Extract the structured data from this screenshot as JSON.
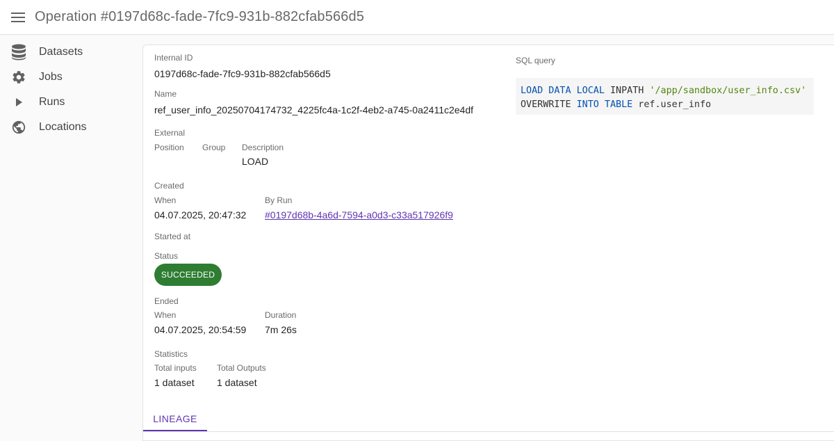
{
  "header": {
    "title": "Operation #0197d68c-fade-7fc9-931b-882cfab566d5",
    "menu_icon": "menu-icon"
  },
  "sidebar": {
    "items": [
      {
        "label": "Datasets",
        "icon": "database-icon"
      },
      {
        "label": "Jobs",
        "icon": "gear-icon"
      },
      {
        "label": "Runs",
        "icon": "play-icon"
      },
      {
        "label": "Locations",
        "icon": "globe-icon"
      }
    ]
  },
  "details": {
    "internal_id_label": "Internal ID",
    "internal_id": "0197d68c-fade-7fc9-931b-882cfab566d5",
    "name_label": "Name",
    "name": "ref_user_info_20250704174732_4225fc4a-1c2f-4eb2-a745-0a2411c2e4df",
    "external_label": "External",
    "position_label": "Position",
    "group_label": "Group",
    "description_label": "Description",
    "description": "LOAD",
    "created_label": "Created",
    "created_when_label": "When",
    "created_when": "04.07.2025, 20:47:32",
    "by_run_label": "By Run",
    "by_run": "#0197d68b-4a6d-7594-a0d3-c33a517926f9",
    "started_label": "Started at",
    "status_label": "Status",
    "status": "SUCCEEDED",
    "status_color": "#2e7d32",
    "ended_label": "Ended",
    "ended_when_label": "When",
    "ended_when": "04.07.2025, 20:54:59",
    "duration_label": "Duration",
    "duration": "7m 26s",
    "statistics_label": "Statistics",
    "total_inputs_label": "Total inputs",
    "total_inputs": "1 dataset",
    "total_outputs_label": "Total Outputs",
    "total_outputs": "1 dataset"
  },
  "sql": {
    "label": "SQL query",
    "line1": {
      "kw1": "LOAD DATA LOCAL",
      "plain1": " INPATH ",
      "str1": "'/app/sandbox/user_info.csv'"
    },
    "line2": {
      "plain1": "OVERWRITE ",
      "kw1": "INTO TABLE",
      "plain2": " ref.user_info"
    }
  },
  "tabs": [
    {
      "label": "LINEAGE",
      "active": true
    }
  ],
  "colors": {
    "accent": "#5e35b1",
    "success": "#2e7d32"
  }
}
